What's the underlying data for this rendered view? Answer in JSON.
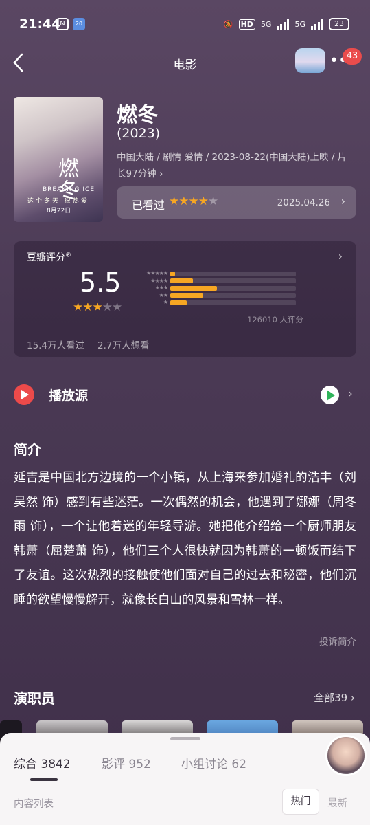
{
  "status_bar": {
    "time": "21:44",
    "notif_icon_1": "N",
    "notif_icon_2": "20",
    "hd_label": "HD",
    "net_label_1": "5G",
    "net_label_2": "5G",
    "battery": "23"
  },
  "nav": {
    "title": "电影",
    "badge_count": "43"
  },
  "movie": {
    "title": "燃冬",
    "year": "(2023)",
    "meta": "中国大陆 / 剧情 爱情 / 2023-08-22(中国大陆)上映 / 片长97分钟 ›",
    "poster": {
      "title": "燃冬",
      "subtitle": "BREAKING ICE",
      "tagline": "这个冬天 很热爱",
      "date": "8月22日"
    }
  },
  "seen": {
    "label": "已看过",
    "stars": 4,
    "date": "2025.04.26"
  },
  "rating": {
    "label": "豆瓣评分",
    "score": "5.5",
    "stars": 3,
    "distribution": [
      {
        "stars": "★★★★★",
        "fraction": 0.04
      },
      {
        "stars": "★★★★",
        "fraction": 0.18
      },
      {
        "stars": "★★★",
        "fraction": 0.37
      },
      {
        "stars": "★★",
        "fraction": 0.26
      },
      {
        "stars": "★",
        "fraction": 0.13
      }
    ],
    "total_raters": "126010 人评分",
    "watched": "15.4万人看过",
    "want": "2.7万人想看",
    "accent_color": "#f6a623"
  },
  "play": {
    "label": "播放源",
    "icon": "play-circle-icon",
    "provider_icon": "google-play-icon"
  },
  "synopsis": {
    "title": "简介",
    "text": "延吉是中国北方边境的一个小镇，从上海来参加婚礼的浩丰（刘昊然 饰）感到有些迷茫。一次偶然的机会，他遇到了娜娜（周冬雨 饰），一个让他着迷的年轻导游。她把他介绍给一个厨师朋友韩萧（屈楚萧 饰），他们三个人很快就因为韩萧的一顿饭而结下了友谊。这次热烈的接触使他们面对自己的过去和秘密，他们沉睡的欲望慢慢解开，就像长白山的风景和雪林一样。",
    "complain": "投诉简介"
  },
  "cast": {
    "title": "演职员",
    "all": "全部39 ›"
  },
  "sheet": {
    "tabs": [
      "综合 3842",
      "影评 952",
      "小组讨论 62"
    ],
    "content_list": "内容列表",
    "sort_hot": "热门",
    "sort_new": "最新"
  }
}
